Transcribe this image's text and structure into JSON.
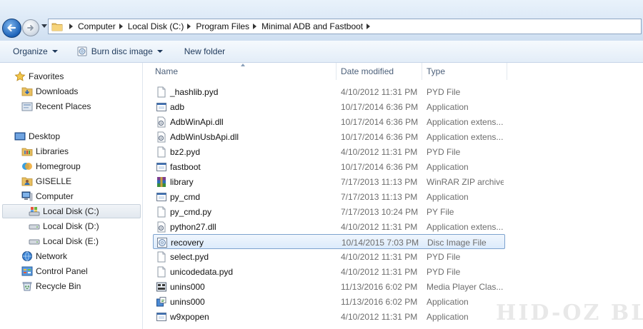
{
  "address": {
    "crumbs": [
      "Computer",
      "Local Disk (C:)",
      "Program Files",
      "Minimal ADB and Fastboot"
    ]
  },
  "toolbar": {
    "organize": "Organize",
    "burn": "Burn disc image",
    "new_folder": "New folder"
  },
  "nav": {
    "favorites": "Favorites",
    "downloads": "Downloads",
    "recent_places": "Recent Places",
    "desktop": "Desktop",
    "libraries": "Libraries",
    "homegroup": "Homegroup",
    "giselle": "GISELLE",
    "computer": "Computer",
    "local_c": "Local Disk (C:)",
    "local_d": "Local Disk (D:)",
    "local_e": "Local Disk (E:)",
    "network": "Network",
    "control_panel": "Control Panel",
    "recycle_bin": "Recycle Bin"
  },
  "columns": {
    "name": "Name",
    "date": "Date modified",
    "type": "Type"
  },
  "files": [
    {
      "name": "_hashlib.pyd",
      "date": "4/10/2012 11:31 PM",
      "type": "PYD File",
      "icon": "blank"
    },
    {
      "name": "adb",
      "date": "10/17/2014 6:36 PM",
      "type": "Application",
      "icon": "app"
    },
    {
      "name": "AdbWinApi.dll",
      "date": "10/17/2014 6:36 PM",
      "type": "Application extens...",
      "icon": "dll"
    },
    {
      "name": "AdbWinUsbApi.dll",
      "date": "10/17/2014 6:36 PM",
      "type": "Application extens...",
      "icon": "dll"
    },
    {
      "name": "bz2.pyd",
      "date": "4/10/2012 11:31 PM",
      "type": "PYD File",
      "icon": "blank"
    },
    {
      "name": "fastboot",
      "date": "10/17/2014 6:36 PM",
      "type": "Application",
      "icon": "app"
    },
    {
      "name": "library",
      "date": "7/17/2013 11:13 PM",
      "type": "WinRAR ZIP archive",
      "icon": "rar"
    },
    {
      "name": "py_cmd",
      "date": "7/17/2013 11:13 PM",
      "type": "Application",
      "icon": "app"
    },
    {
      "name": "py_cmd.py",
      "date": "7/17/2013 10:24 PM",
      "type": "PY File",
      "icon": "blank"
    },
    {
      "name": "python27.dll",
      "date": "4/10/2012 11:31 PM",
      "type": "Application extens...",
      "icon": "dll"
    },
    {
      "name": "recovery",
      "date": "10/14/2015 7:03 PM",
      "type": "Disc Image File",
      "icon": "disc"
    },
    {
      "name": "select.pyd",
      "date": "4/10/2012 11:31 PM",
      "type": "PYD File",
      "icon": "blank"
    },
    {
      "name": "unicodedata.pyd",
      "date": "4/10/2012 11:31 PM",
      "type": "PYD File",
      "icon": "blank"
    },
    {
      "name": "unins000",
      "date": "11/13/2016 6:02 PM",
      "type": "Media Player Clas...",
      "icon": "media"
    },
    {
      "name": "unins000",
      "date": "11/13/2016 6:02 PM",
      "type": "Application",
      "icon": "setup"
    },
    {
      "name": "w9xpopen",
      "date": "4/10/2012 11:31 PM",
      "type": "Application",
      "icon": "app"
    }
  ],
  "watermark": "HID-OZ BLOG"
}
